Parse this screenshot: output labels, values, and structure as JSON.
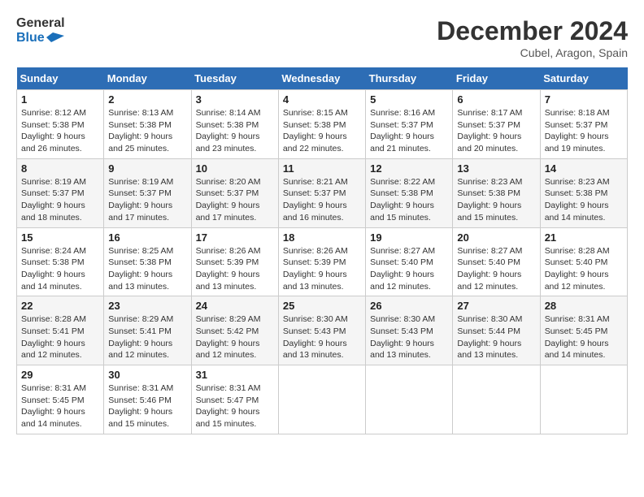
{
  "logo": {
    "line1": "General",
    "line2": "Blue"
  },
  "title": "December 2024",
  "subtitle": "Cubel, Aragon, Spain",
  "days_of_week": [
    "Sunday",
    "Monday",
    "Tuesday",
    "Wednesday",
    "Thursday",
    "Friday",
    "Saturday"
  ],
  "weeks": [
    [
      {
        "day": "1",
        "sunrise": "Sunrise: 8:12 AM",
        "sunset": "Sunset: 5:38 PM",
        "daylight": "Daylight: 9 hours and 26 minutes."
      },
      {
        "day": "2",
        "sunrise": "Sunrise: 8:13 AM",
        "sunset": "Sunset: 5:38 PM",
        "daylight": "Daylight: 9 hours and 25 minutes."
      },
      {
        "day": "3",
        "sunrise": "Sunrise: 8:14 AM",
        "sunset": "Sunset: 5:38 PM",
        "daylight": "Daylight: 9 hours and 23 minutes."
      },
      {
        "day": "4",
        "sunrise": "Sunrise: 8:15 AM",
        "sunset": "Sunset: 5:38 PM",
        "daylight": "Daylight: 9 hours and 22 minutes."
      },
      {
        "day": "5",
        "sunrise": "Sunrise: 8:16 AM",
        "sunset": "Sunset: 5:37 PM",
        "daylight": "Daylight: 9 hours and 21 minutes."
      },
      {
        "day": "6",
        "sunrise": "Sunrise: 8:17 AM",
        "sunset": "Sunset: 5:37 PM",
        "daylight": "Daylight: 9 hours and 20 minutes."
      },
      {
        "day": "7",
        "sunrise": "Sunrise: 8:18 AM",
        "sunset": "Sunset: 5:37 PM",
        "daylight": "Daylight: 9 hours and 19 minutes."
      }
    ],
    [
      {
        "day": "8",
        "sunrise": "Sunrise: 8:19 AM",
        "sunset": "Sunset: 5:37 PM",
        "daylight": "Daylight: 9 hours and 18 minutes."
      },
      {
        "day": "9",
        "sunrise": "Sunrise: 8:19 AM",
        "sunset": "Sunset: 5:37 PM",
        "daylight": "Daylight: 9 hours and 17 minutes."
      },
      {
        "day": "10",
        "sunrise": "Sunrise: 8:20 AM",
        "sunset": "Sunset: 5:37 PM",
        "daylight": "Daylight: 9 hours and 17 minutes."
      },
      {
        "day": "11",
        "sunrise": "Sunrise: 8:21 AM",
        "sunset": "Sunset: 5:37 PM",
        "daylight": "Daylight: 9 hours and 16 minutes."
      },
      {
        "day": "12",
        "sunrise": "Sunrise: 8:22 AM",
        "sunset": "Sunset: 5:38 PM",
        "daylight": "Daylight: 9 hours and 15 minutes."
      },
      {
        "day": "13",
        "sunrise": "Sunrise: 8:23 AM",
        "sunset": "Sunset: 5:38 PM",
        "daylight": "Daylight: 9 hours and 15 minutes."
      },
      {
        "day": "14",
        "sunrise": "Sunrise: 8:23 AM",
        "sunset": "Sunset: 5:38 PM",
        "daylight": "Daylight: 9 hours and 14 minutes."
      }
    ],
    [
      {
        "day": "15",
        "sunrise": "Sunrise: 8:24 AM",
        "sunset": "Sunset: 5:38 PM",
        "daylight": "Daylight: 9 hours and 14 minutes."
      },
      {
        "day": "16",
        "sunrise": "Sunrise: 8:25 AM",
        "sunset": "Sunset: 5:38 PM",
        "daylight": "Daylight: 9 hours and 13 minutes."
      },
      {
        "day": "17",
        "sunrise": "Sunrise: 8:26 AM",
        "sunset": "Sunset: 5:39 PM",
        "daylight": "Daylight: 9 hours and 13 minutes."
      },
      {
        "day": "18",
        "sunrise": "Sunrise: 8:26 AM",
        "sunset": "Sunset: 5:39 PM",
        "daylight": "Daylight: 9 hours and 13 minutes."
      },
      {
        "day": "19",
        "sunrise": "Sunrise: 8:27 AM",
        "sunset": "Sunset: 5:40 PM",
        "daylight": "Daylight: 9 hours and 12 minutes."
      },
      {
        "day": "20",
        "sunrise": "Sunrise: 8:27 AM",
        "sunset": "Sunset: 5:40 PM",
        "daylight": "Daylight: 9 hours and 12 minutes."
      },
      {
        "day": "21",
        "sunrise": "Sunrise: 8:28 AM",
        "sunset": "Sunset: 5:40 PM",
        "daylight": "Daylight: 9 hours and 12 minutes."
      }
    ],
    [
      {
        "day": "22",
        "sunrise": "Sunrise: 8:28 AM",
        "sunset": "Sunset: 5:41 PM",
        "daylight": "Daylight: 9 hours and 12 minutes."
      },
      {
        "day": "23",
        "sunrise": "Sunrise: 8:29 AM",
        "sunset": "Sunset: 5:41 PM",
        "daylight": "Daylight: 9 hours and 12 minutes."
      },
      {
        "day": "24",
        "sunrise": "Sunrise: 8:29 AM",
        "sunset": "Sunset: 5:42 PM",
        "daylight": "Daylight: 9 hours and 12 minutes."
      },
      {
        "day": "25",
        "sunrise": "Sunrise: 8:30 AM",
        "sunset": "Sunset: 5:43 PM",
        "daylight": "Daylight: 9 hours and 13 minutes."
      },
      {
        "day": "26",
        "sunrise": "Sunrise: 8:30 AM",
        "sunset": "Sunset: 5:43 PM",
        "daylight": "Daylight: 9 hours and 13 minutes."
      },
      {
        "day": "27",
        "sunrise": "Sunrise: 8:30 AM",
        "sunset": "Sunset: 5:44 PM",
        "daylight": "Daylight: 9 hours and 13 minutes."
      },
      {
        "day": "28",
        "sunrise": "Sunrise: 8:31 AM",
        "sunset": "Sunset: 5:45 PM",
        "daylight": "Daylight: 9 hours and 14 minutes."
      }
    ],
    [
      {
        "day": "29",
        "sunrise": "Sunrise: 8:31 AM",
        "sunset": "Sunset: 5:45 PM",
        "daylight": "Daylight: 9 hours and 14 minutes."
      },
      {
        "day": "30",
        "sunrise": "Sunrise: 8:31 AM",
        "sunset": "Sunset: 5:46 PM",
        "daylight": "Daylight: 9 hours and 15 minutes."
      },
      {
        "day": "31",
        "sunrise": "Sunrise: 8:31 AM",
        "sunset": "Sunset: 5:47 PM",
        "daylight": "Daylight: 9 hours and 15 minutes."
      },
      null,
      null,
      null,
      null
    ]
  ]
}
